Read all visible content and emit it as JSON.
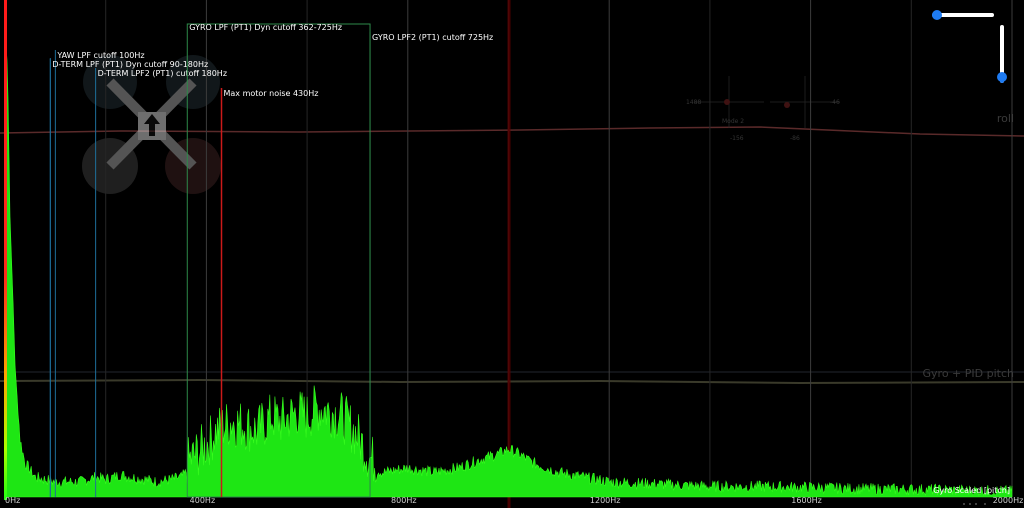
{
  "chart_data": {
    "type": "area",
    "x_unit": "Hz",
    "xlim": [
      0,
      2000
    ],
    "ticks": [
      {
        "value": 0,
        "label": "0Hz"
      },
      {
        "value": 400,
        "label": "400Hz"
      },
      {
        "value": 800,
        "label": "800Hz"
      },
      {
        "value": 1200,
        "label": "1200Hz"
      },
      {
        "value": 1600,
        "label": "1600Hz"
      },
      {
        "value": 2000,
        "label": "2000Hz"
      }
    ],
    "series_label": "Gyro Scaled [pitch]",
    "spectrum": {
      "x": [
        0,
        5,
        10,
        15,
        20,
        30,
        40,
        60,
        80,
        100,
        120,
        150,
        180,
        200,
        230,
        250,
        280,
        300,
        330,
        350,
        360,
        380,
        400,
        420,
        450,
        480,
        500,
        530,
        550,
        580,
        600,
        620,
        650,
        670,
        700,
        725,
        750,
        800,
        850,
        900,
        950,
        980,
        1000,
        1020,
        1050,
        1100,
        1150,
        1200,
        1300,
        1400,
        1500,
        1600,
        1700,
        1800,
        1900,
        2000
      ],
      "y": [
        1.0,
        0.92,
        0.6,
        0.45,
        0.28,
        0.12,
        0.07,
        0.04,
        0.035,
        0.03,
        0.03,
        0.03,
        0.04,
        0.035,
        0.045,
        0.04,
        0.035,
        0.03,
        0.035,
        0.04,
        0.05,
        0.07,
        0.09,
        0.12,
        0.14,
        0.13,
        0.12,
        0.15,
        0.14,
        0.16,
        0.15,
        0.17,
        0.16,
        0.15,
        0.11,
        0.06,
        0.05,
        0.06,
        0.05,
        0.06,
        0.08,
        0.09,
        0.1,
        0.09,
        0.07,
        0.05,
        0.04,
        0.03,
        0.025,
        0.02,
        0.02,
        0.018,
        0.015,
        0.014,
        0.012,
        0.01
      ]
    },
    "markers": [
      {
        "label": "YAW LPF cutoff 100Hz",
        "freq": 100,
        "color": "#1e6f9a",
        "kind": "line"
      },
      {
        "label": "D-TERM LPF (PT1) Dyn cutoff 90-180Hz",
        "freq": 90,
        "freq_end": 180,
        "color": "#1e6f9a",
        "kind": "line"
      },
      {
        "label": "D-TERM LPF2 (PT1) cutoff 180Hz",
        "freq": 180,
        "color": "#1e6f9a",
        "kind": "line"
      },
      {
        "label": "GYRO LPF (PT1) Dyn cutoff 362-725Hz",
        "freq": 362,
        "freq_end": 725,
        "color": "#2e8a4a",
        "kind": "range"
      },
      {
        "label": "GYRO LPF2 (PT1) cutoff 725Hz",
        "freq": 725,
        "color": "#2e8a4a",
        "kind": "line"
      },
      {
        "label": "Max motor noise 430Hz",
        "freq": 430,
        "color": "#cc1a1a",
        "kind": "line"
      }
    ],
    "grid": true,
    "legend": "bottom-right"
  },
  "overlay": {
    "roll_label": "roll",
    "pitch_label": "Gyro + PID pitch",
    "stick_values": {
      "left_top": "1488",
      "right_top": "-46",
      "left_bottom": "-156",
      "right_bottom": "-86",
      "mode": "Mode 2"
    }
  },
  "colors": {
    "spectrum_fill": "#1ee614",
    "spectrum_edge": "#39ff1f",
    "grid": "#3c3c3c",
    "accent_slider": "#1e7bf2"
  }
}
